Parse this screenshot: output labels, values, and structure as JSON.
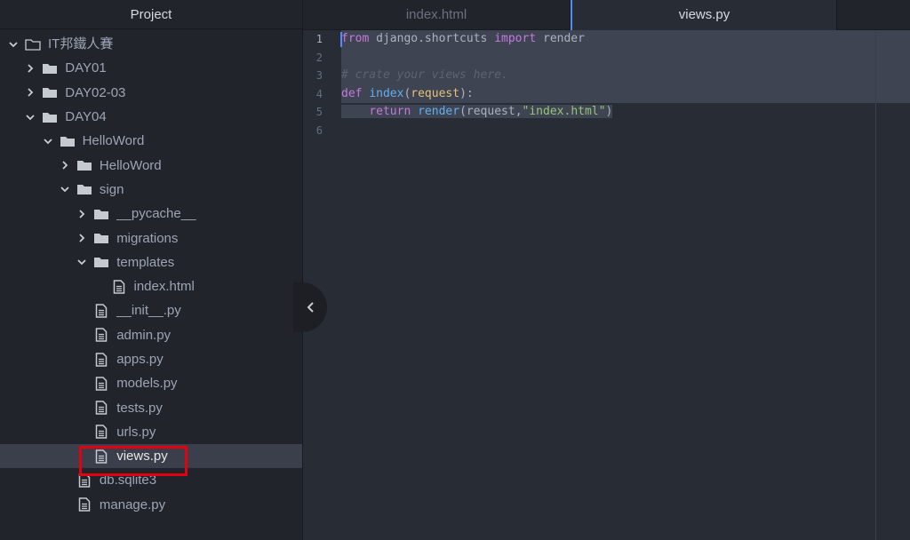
{
  "sidebar": {
    "title": "Project",
    "tree": [
      {
        "label": "IT邦鐵人賽",
        "type": "folder",
        "depth": 0,
        "expanded": true,
        "icon": "folder-open-icon"
      },
      {
        "label": "DAY01",
        "type": "folder",
        "depth": 1,
        "expanded": false
      },
      {
        "label": "DAY02-03",
        "type": "folder",
        "depth": 1,
        "expanded": false
      },
      {
        "label": "DAY04",
        "type": "folder",
        "depth": 1,
        "expanded": true
      },
      {
        "label": "HelloWord",
        "type": "folder",
        "depth": 2,
        "expanded": true
      },
      {
        "label": "HelloWord",
        "type": "folder",
        "depth": 3,
        "expanded": false
      },
      {
        "label": "sign",
        "type": "folder",
        "depth": 3,
        "expanded": true
      },
      {
        "label": "__pycache__",
        "type": "folder",
        "depth": 4,
        "expanded": false
      },
      {
        "label": "migrations",
        "type": "folder",
        "depth": 4,
        "expanded": false
      },
      {
        "label": "templates",
        "type": "folder",
        "depth": 4,
        "expanded": true
      },
      {
        "label": "index.html",
        "type": "file",
        "depth": 5
      },
      {
        "label": "__init__.py",
        "type": "file",
        "depth": 4
      },
      {
        "label": "admin.py",
        "type": "file",
        "depth": 4
      },
      {
        "label": "apps.py",
        "type": "file",
        "depth": 4
      },
      {
        "label": "models.py",
        "type": "file",
        "depth": 4
      },
      {
        "label": "tests.py",
        "type": "file",
        "depth": 4
      },
      {
        "label": "urls.py",
        "type": "file",
        "depth": 4
      },
      {
        "label": "views.py",
        "type": "file",
        "depth": 4,
        "selected": true,
        "highlighted": true
      },
      {
        "label": "db.sqlite3",
        "type": "file",
        "depth": 3
      },
      {
        "label": "manage.py",
        "type": "file",
        "depth": 3
      }
    ]
  },
  "tabs": [
    {
      "label": "index.html",
      "active": false
    },
    {
      "label": "views.py",
      "active": true
    }
  ],
  "editor": {
    "current_line": 1,
    "lines": [
      [
        {
          "t": "from",
          "c": "kw"
        },
        {
          "t": " django.shortcuts ",
          "c": ""
        },
        {
          "t": "import",
          "c": "kw"
        },
        {
          "t": " render",
          "c": ""
        }
      ],
      [],
      [
        {
          "t": "# crate your views here.",
          "c": "cmt"
        }
      ],
      [
        {
          "t": "def",
          "c": "kw"
        },
        {
          "t": " ",
          "c": ""
        },
        {
          "t": "index",
          "c": "fn"
        },
        {
          "t": "(",
          "c": ""
        },
        {
          "t": "request",
          "c": "param"
        },
        {
          "t": "):",
          "c": ""
        }
      ],
      [
        {
          "t": "    ",
          "c": ""
        },
        {
          "t": "return",
          "c": "kw"
        },
        {
          "t": " ",
          "c": ""
        },
        {
          "t": "render",
          "c": "fn"
        },
        {
          "t": "(request,",
          "c": ""
        },
        {
          "t": "\"index.html\"",
          "c": "str"
        },
        {
          "t": ")",
          "c": ""
        }
      ],
      []
    ],
    "selected_lines": [
      1,
      2,
      3,
      4,
      5
    ]
  },
  "colors": {
    "highlight_box": "#e3000f",
    "accent": "#568af2"
  }
}
